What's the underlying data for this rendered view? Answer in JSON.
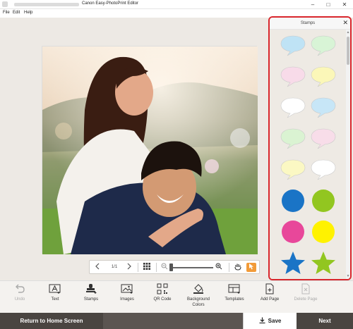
{
  "window": {
    "title": "Canon Easy-PhotoPrint Editor",
    "minimize_glyph": "–",
    "maximize_glyph": "□",
    "close_glyph": "✕"
  },
  "menu": {
    "file": "File",
    "edit": "Edit",
    "help": "Help"
  },
  "navigator": {
    "page_indicator": "1/1"
  },
  "stamps_panel": {
    "title": "Stamps",
    "close_glyph": "✕",
    "items": [
      {
        "shape": "speech-bubble",
        "color": "#bfe3f5"
      },
      {
        "shape": "speech-bubble",
        "color": "#d8f4d6"
      },
      {
        "shape": "speech-bubble",
        "color": "#f8dbe9"
      },
      {
        "shape": "speech-bubble",
        "color": "#fbf7b8"
      },
      {
        "shape": "speech-bubble",
        "color": "#ffffff"
      },
      {
        "shape": "speech-bubble",
        "color": "#c7e6f7"
      },
      {
        "shape": "speech-bubble",
        "color": "#daf3d2"
      },
      {
        "shape": "speech-bubble",
        "color": "#f8dde9"
      },
      {
        "shape": "speech-bubble",
        "color": "#fbf8c3"
      },
      {
        "shape": "speech-bubble",
        "color": "#ffffff"
      },
      {
        "shape": "circle",
        "color": "#1a74c6"
      },
      {
        "shape": "circle",
        "color": "#92c620"
      },
      {
        "shape": "circle",
        "color": "#e8479a"
      },
      {
        "shape": "circle",
        "color": "#fff200"
      },
      {
        "shape": "star",
        "color": "#1a74c6"
      },
      {
        "shape": "star",
        "color": "#92c620"
      }
    ]
  },
  "toolbar": {
    "undo": "Undo",
    "text": "Text",
    "stamps": "Stamps",
    "images": "Images",
    "qr_code": "QR Code",
    "background_colors_line1": "Background",
    "background_colors_line2": "Colors",
    "templates": "Templates",
    "add_page": "Add Page",
    "delete_page": "Delete Page"
  },
  "footer": {
    "return_home": "Return to Home Screen",
    "save": "Save",
    "next": "Next"
  },
  "colors": {
    "panel_highlight": "#d9262c",
    "active_tool": "#f29b38",
    "footer_dark": "#4a4541"
  }
}
